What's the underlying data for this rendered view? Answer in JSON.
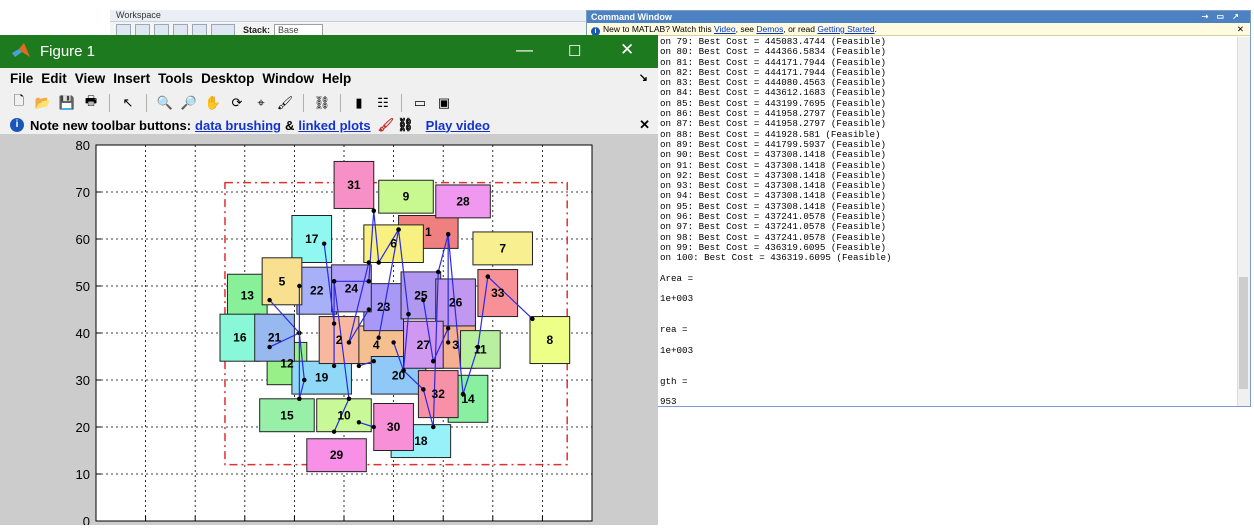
{
  "workspace": {
    "title": "Workspace",
    "stack_label": "Stack:",
    "stack_value": "Base"
  },
  "command_window": {
    "title": "Command Window",
    "info_prefix": "New to MATLAB? Watch this ",
    "info_video": "Video",
    "info_mid1": ", see ",
    "info_demos": "Demos",
    "info_mid2": ", or read ",
    "info_getting_started": "Getting Started",
    "info_suffix": ".",
    "lines": [
      "on 79: Best Cost = 445083.4744 (Feasible)",
      "on 80: Best Cost = 444366.5834 (Feasible)",
      "on 81: Best Cost = 444171.7944 (Feasible)",
      "on 82: Best Cost = 444171.7944 (Feasible)",
      "on 83: Best Cost = 444080.4563 (Feasible)",
      "on 84: Best Cost = 443612.1683 (Feasible)",
      "on 85: Best Cost = 443199.7695 (Feasible)",
      "on 86: Best Cost = 441958.2797 (Feasible)",
      "on 87: Best Cost = 441958.2797 (Feasible)",
      "on 88: Best Cost = 441928.581 (Feasible)",
      "on 89: Best Cost = 441799.5937 (Feasible)",
      "on 90: Best Cost = 437308.1418 (Feasible)",
      "on 91: Best Cost = 437308.1418 (Feasible)",
      "on 92: Best Cost = 437308.1418 (Feasible)",
      "on 93: Best Cost = 437308.1418 (Feasible)",
      "on 94: Best Cost = 437308.1418 (Feasible)",
      "on 95: Best Cost = 437308.1418 (Feasible)",
      "on 96: Best Cost = 437241.0578 (Feasible)",
      "on 97: Best Cost = 437241.0578 (Feasible)",
      "on 98: Best Cost = 437241.0578 (Feasible)",
      "on 99: Best Cost = 436319.6095 (Feasible)",
      "on 100: Best Cost = 436319.6095 (Feasible)",
      "",
      "Area =",
      "",
      "1e+003",
      "",
      "",
      "rea =",
      "",
      "1e+003",
      "",
      "",
      "gth =",
      "",
      "953"
    ]
  },
  "figure": {
    "title": "Figure 1",
    "menu": [
      "File",
      "Edit",
      "View",
      "Insert",
      "Tools",
      "Desktop",
      "Window",
      "Help"
    ],
    "note_prefix": "Note new toolbar buttons:",
    "note_link1": "data brushing",
    "note_amp": "&",
    "note_link2": "linked plots",
    "note_video": "Play video"
  },
  "chart_data": {
    "type": "scatter",
    "title": "",
    "xlabel": "",
    "ylabel": "",
    "xlim": [
      0,
      100
    ],
    "ylim": [
      0,
      80
    ],
    "xticks": [
      0,
      10,
      20,
      30,
      40,
      50,
      60,
      70,
      80,
      90,
      100
    ],
    "yticks": [
      0,
      10,
      20,
      30,
      40,
      50,
      60,
      70,
      80
    ],
    "grid": true,
    "boundary": {
      "x": [
        26,
        95
      ],
      "y": [
        12,
        72
      ],
      "color": "#e03030"
    },
    "facilities": [
      {
        "id": "1",
        "x": 67,
        "y": 61.5,
        "w": 12,
        "h": 7,
        "color": "#f08080"
      },
      {
        "id": "3",
        "x": 72.5,
        "y": 37.5,
        "w": 8,
        "h": 10,
        "color": "#f4b090"
      },
      {
        "id": "4",
        "x": 56.5,
        "y": 37.5,
        "w": 11,
        "h": 8,
        "color": "#f4c090"
      },
      {
        "id": "6",
        "x": 60,
        "y": 59,
        "w": 12,
        "h": 8,
        "color": "#f8f080"
      },
      {
        "id": "7",
        "x": 82,
        "y": 58,
        "w": 12,
        "h": 7,
        "color": "#f8f090"
      },
      {
        "id": "8",
        "x": 91.5,
        "y": 38.5,
        "w": 8,
        "h": 10,
        "color": "#eeff88"
      },
      {
        "id": "9",
        "x": 62.5,
        "y": 69,
        "w": 11,
        "h": 7,
        "color": "#c8f890"
      },
      {
        "id": "11",
        "x": 77.5,
        "y": 36.5,
        "w": 8,
        "h": 8,
        "color": "#b8f0a0"
      },
      {
        "id": "12",
        "x": 38.5,
        "y": 33.5,
        "w": 8,
        "h": 9,
        "color": "#98f088"
      },
      {
        "id": "13",
        "x": 30.5,
        "y": 48,
        "w": 8,
        "h": 9,
        "color": "#88f098"
      },
      {
        "id": "14",
        "x": 75,
        "y": 26,
        "w": 8,
        "h": 10,
        "color": "#88f0a0"
      },
      {
        "id": "15",
        "x": 38.5,
        "y": 22.5,
        "w": 11,
        "h": 7,
        "color": "#98f0a8"
      },
      {
        "id": "16",
        "x": 29,
        "y": 39,
        "w": 8,
        "h": 10,
        "color": "#88f8d8"
      },
      {
        "id": "17",
        "x": 43.5,
        "y": 60,
        "w": 8,
        "h": 10,
        "color": "#90f8f0"
      },
      {
        "id": "18",
        "x": 65.5,
        "y": 17,
        "w": 12,
        "h": 7,
        "color": "#98f0f8"
      },
      {
        "id": "19",
        "x": 45.5,
        "y": 30.5,
        "w": 12,
        "h": 7,
        "color": "#90d8f8"
      },
      {
        "id": "20",
        "x": 61,
        "y": 31,
        "w": 11,
        "h": 8,
        "color": "#90c8f8"
      },
      {
        "id": "21",
        "x": 36,
        "y": 39,
        "w": 8,
        "h": 10,
        "color": "#98b8f0"
      },
      {
        "id": "22",
        "x": 44.5,
        "y": 49,
        "w": 8,
        "h": 10,
        "color": "#a8b0f8"
      },
      {
        "id": "23",
        "x": 58,
        "y": 45.5,
        "w": 8,
        "h": 10,
        "color": "#a898f8"
      },
      {
        "id": "24",
        "x": 51.5,
        "y": 49.5,
        "w": 8,
        "h": 10,
        "color": "#b0a0f8"
      },
      {
        "id": "25",
        "x": 65.5,
        "y": 48,
        "w": 8,
        "h": 10,
        "color": "#b098f0"
      },
      {
        "id": "26",
        "x": 72.5,
        "y": 46.5,
        "w": 8,
        "h": 10,
        "color": "#c098f0"
      },
      {
        "id": "27",
        "x": 66,
        "y": 37.5,
        "w": 8,
        "h": 10,
        "color": "#d098f0"
      },
      {
        "id": "28",
        "x": 74,
        "y": 68,
        "w": 11,
        "h": 7,
        "color": "#f098f0"
      },
      {
        "id": "29",
        "x": 48.5,
        "y": 14,
        "w": 12,
        "h": 7,
        "color": "#f890e8"
      },
      {
        "id": "30",
        "x": 60,
        "y": 20,
        "w": 8,
        "h": 10,
        "color": "#f890d8"
      },
      {
        "id": "31",
        "x": 52,
        "y": 71.5,
        "w": 8,
        "h": 10,
        "color": "#f890c8"
      },
      {
        "id": "32",
        "x": 69,
        "y": 27,
        "w": 8,
        "h": 10,
        "color": "#f890a8"
      },
      {
        "id": "33",
        "x": 81,
        "y": 48.5,
        "w": 8,
        "h": 10,
        "color": "#f89098"
      },
      {
        "id": "2",
        "x": 49,
        "y": 38.5,
        "w": 8,
        "h": 10,
        "color": "#f8b8a0"
      },
      {
        "id": "5",
        "x": 37.5,
        "y": 51,
        "w": 8,
        "h": 10,
        "color": "#f8e090"
      },
      {
        "id": "10",
        "x": 50,
        "y": 22.5,
        "w": 11,
        "h": 7,
        "color": "#c8f898"
      }
    ],
    "connections": [
      [
        35,
        47,
        41,
        40
      ],
      [
        41,
        40,
        35,
        37
      ],
      [
        41,
        40,
        42,
        30
      ],
      [
        42,
        30,
        41,
        26
      ],
      [
        48,
        33,
        48,
        51
      ],
      [
        48,
        51,
        55,
        51
      ],
      [
        55,
        51,
        56,
        66
      ],
      [
        56,
        66,
        57,
        55
      ],
      [
        57,
        55,
        61,
        62
      ],
      [
        61,
        62,
        63,
        44
      ],
      [
        63,
        44,
        62,
        32
      ],
      [
        62,
        32,
        66,
        28
      ],
      [
        66,
        28,
        68,
        20
      ],
      [
        68,
        20,
        69,
        53
      ],
      [
        69,
        53,
        71,
        61
      ],
      [
        71,
        61,
        74,
        27
      ],
      [
        74,
        27,
        77,
        37
      ],
      [
        77,
        37,
        79,
        52
      ],
      [
        79,
        52,
        88,
        43
      ],
      [
        71,
        38,
        71,
        61
      ],
      [
        48,
        19,
        51,
        26
      ],
      [
        51,
        26,
        48,
        51
      ],
      [
        41,
        50,
        41,
        26
      ],
      [
        46,
        59,
        48,
        42
      ],
      [
        55,
        45,
        51,
        38
      ],
      [
        51,
        38,
        55,
        55
      ],
      [
        57,
        39,
        61,
        62
      ],
      [
        60,
        38,
        62,
        32
      ],
      [
        66,
        47,
        68,
        34
      ],
      [
        68,
        34,
        71,
        41
      ],
      [
        53,
        33,
        56,
        34
      ],
      [
        53,
        21,
        56,
        20
      ]
    ]
  }
}
